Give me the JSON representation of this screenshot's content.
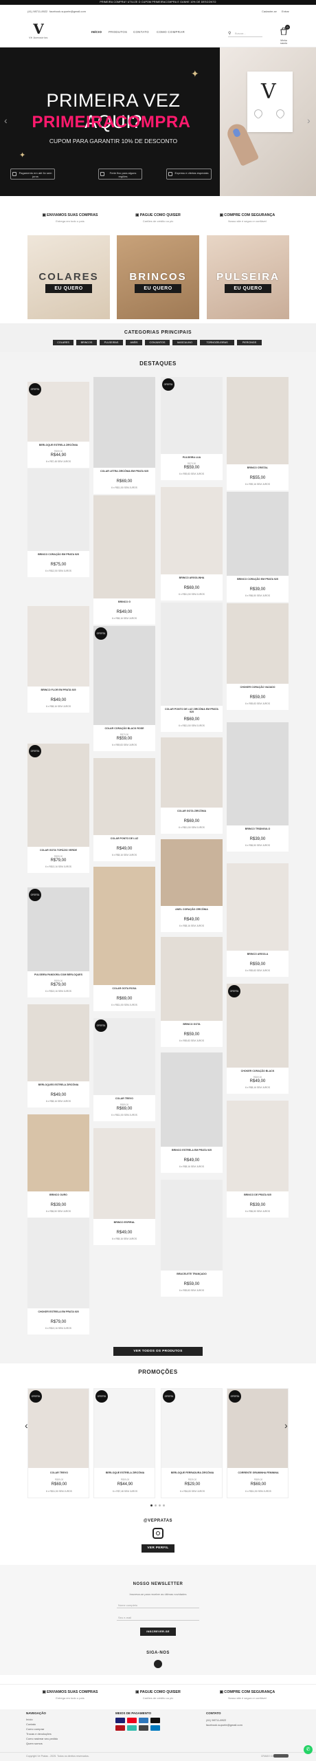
{
  "topbar": {
    "text": "PRIMEIRA COMPRA? UTILIZE O CUPOM PRIMEIRACOMPRA E GANHE 10% DE DESCONTO"
  },
  "info": {
    "phone": "(41) 98711-8922",
    "email": "facebook.suporte@gmail.com",
    "account": "Cadastre-se",
    "login": "Entrar"
  },
  "brand": {
    "mark": "V",
    "name": "Vê Acessórios"
  },
  "nav": [
    "INÍCIO",
    "PRODUTOS",
    "CONTATO",
    "COMO COMPRAR"
  ],
  "search": {
    "placeholder": "Buscar..."
  },
  "cart": {
    "count": "0",
    "label": "Minha sacola"
  },
  "hero": {
    "line1": "PRIMEIRA VEZ AQUI?",
    "line2": "PRIMEIRACOMPRA",
    "line3": "CUPOM PARA GARANTIR 10% DE DESCONTO",
    "perks": [
      "Pagamento em até 6x sem juros",
      "Frete fixo para alguns regiões",
      "Express e ofertas especiais"
    ],
    "accent": "#ff1a6e"
  },
  "features": [
    {
      "title": "ENVIAMOS SUAS COMPRAS",
      "sub": "Entrega em todo o país"
    },
    {
      "title": "PAGUE COMO QUISER",
      "sub": "Cartões de crédito ou pix"
    },
    {
      "title": "COMPRE COM SEGURANÇA",
      "sub": "Nosso site é seguro e confiável"
    }
  ],
  "categories": [
    {
      "title": "COLARES",
      "cta": "EU QUERO"
    },
    {
      "title": "BRINCOS",
      "cta": "EU QUERO"
    },
    {
      "title": "PULSEIRA",
      "cta": "EU QUERO"
    }
  ],
  "cats_principais": {
    "title": "CATEGORIAS PRINCIPAIS",
    "items": [
      "COLARES",
      "BRINCOS",
      "PULSEIRAS",
      "ANÉIS",
      "CONJUNTOS",
      "MASCULINO",
      "TORNOZELEIRAS",
      "PIERCINGS"
    ]
  },
  "destaques": {
    "title": "DESTAQUES",
    "badge": "OFERTA",
    "see_all": "VER TODOS OS PRODUTOS"
  },
  "products": [
    {
      "name": "BERLOQUE ESTRELA ZIRCÔNIA",
      "old": "R$59,00",
      "price": "R$44,90",
      "inst": "6 x R$7,48 SEM JUROS"
    },
    {
      "name": "COLAR LETRA ZIRCÔNIA EM PRATA 925",
      "old": "",
      "price": "R$69,00",
      "inst": "6 x R$11,50 SEM JUROS"
    },
    {
      "name": "PULSEIRA LUA",
      "old": "R$79,90",
      "price": "R$59,00",
      "inst": "6 x R$9,83 SEM JUROS"
    },
    {
      "name": "BRINCO CRISTAL",
      "old": "",
      "price": "R$55,00",
      "inst": "6 x R$9,16 SEM JUROS"
    },
    {
      "name": "BRINCO CORAÇÃO EM PRATA 925",
      "old": "",
      "price": "R$75,00",
      "inst": "6 x R$12,50 SEM JUROS"
    },
    {
      "name": "BRINCO G",
      "old": "",
      "price": "R$49,00",
      "inst": "6 x R$8,16 SEM JUROS"
    },
    {
      "name": "BRINCO ARGOLINHA",
      "old": "",
      "price": "R$69,00",
      "inst": "6 x R$11,50 SEM JUROS"
    },
    {
      "name": "BRINCO CORAÇÃO EM PRATA 925",
      "old": "",
      "price": "R$39,00",
      "inst": "6 x R$6,50 SEM JUROS"
    },
    {
      "name": "BRINCO FLOR EM PRATA 925",
      "old": "",
      "price": "R$49,00",
      "inst": "6 x R$8,16 SEM JUROS"
    },
    {
      "name": "COLAR CORAÇÃO BLACK ROSE",
      "old": "R$79,90",
      "price": "R$59,00",
      "inst": "6 x R$9,83 SEM JUROS"
    },
    {
      "name": "COLAR PONTO DE LUZ ZIRCÔNIA EM PRATA 925",
      "old": "",
      "price": "R$69,00",
      "inst": "6 x R$11,50 SEM JUROS"
    },
    {
      "name": "CHOKER CORAÇÃO VAZADO",
      "old": "",
      "price": "R$59,00",
      "inst": "6 x R$9,83 SEM JUROS"
    },
    {
      "name": "COLAR GOTA ZIRCÔNIA",
      "old": "",
      "price": "R$69,00",
      "inst": "6 x R$11,50 SEM JUROS"
    },
    {
      "name": "COLAR PONTO DE LUZ",
      "old": "",
      "price": "R$49,00",
      "inst": "6 x R$8,16 SEM JUROS"
    },
    {
      "name": "COLAR GOTA TOPÁZIO VERDE",
      "old": "R$99,00",
      "price": "R$79,00",
      "inst": "6 x R$13,16 SEM JUROS"
    },
    {
      "name": "BRINCO TRIÂNGULO",
      "old": "",
      "price": "R$39,00",
      "inst": "6 x R$6,50 SEM JUROS"
    },
    {
      "name": "COLAR GOTA ROSA",
      "old": "",
      "price": "R$69,00",
      "inst": "6 x R$11,50 SEM JUROS"
    },
    {
      "name": "ANEL CORAÇÃO ZIRCÔNIA",
      "old": "",
      "price": "R$49,00",
      "inst": "6 x R$8,16 SEM JUROS"
    },
    {
      "name": "PULSEIRA PANDORA COM BERLOQUES",
      "old": "R$99,00",
      "price": "R$79,00",
      "inst": "6 x R$13,16 SEM JUROS"
    },
    {
      "name": "COLAR TREVO",
      "old": "R$89,00",
      "price": "R$69,00",
      "inst": "6 x R$11,50 SEM JUROS"
    },
    {
      "name": "BRINCO GOTA",
      "old": "",
      "price": "R$59,00",
      "inst": "6 x R$9,83 SEM JUROS"
    },
    {
      "name": "BRINCO ARGOLA",
      "old": "",
      "price": "R$59,00",
      "inst": "6 x R$9,83 SEM JUROS"
    },
    {
      "name": "BERLOQUES ESTRELA ZIRCÔNIA",
      "old": "",
      "price": "R$49,00",
      "inst": "6 x R$8,16 SEM JUROS"
    },
    {
      "name": "BRINCO ESPIRAL",
      "old": "",
      "price": "R$49,00",
      "inst": "6 x R$8,16 SEM JUROS"
    },
    {
      "name": "BRINCO ESTRELA EM PRATA 925",
      "old": "",
      "price": "R$49,00",
      "inst": "6 x R$8,16 SEM JUROS"
    },
    {
      "name": "BRINCO OURO",
      "old": "",
      "price": "R$39,00",
      "inst": "6 x R$6,50 SEM JUROS"
    },
    {
      "name": "BRACELETE TRANÇADO",
      "old": "",
      "price": "R$59,00",
      "inst": "6 x R$9,83 SEM JUROS"
    },
    {
      "name": "CHOKER CORAÇÃO BLACK",
      "old": "R$69,00",
      "price": "R$49,00",
      "inst": "6 x R$8,16 SEM JUROS"
    },
    {
      "name": "CHOKER ESTRELA EM PRATA 925",
      "old": "",
      "price": "R$79,00",
      "inst": "6 x R$13,16 SEM JUROS"
    },
    {
      "name": "BRINCO DE PRATA 925",
      "old": "",
      "price": "R$39,00",
      "inst": "6 x R$6,50 SEM JUROS"
    }
  ],
  "promocoes": {
    "title": "PROMOÇÕES",
    "items": [
      {
        "name": "COLAR TREVO",
        "old": "R$89,00",
        "price": "R$69,00",
        "inst": "6 x R$11,50 SEM JUROS"
      },
      {
        "name": "BERLOQUE ESTRELA ZIRCÔNIA",
        "old": "R$59,00",
        "price": "R$44,90",
        "inst": "6 x R$7,48 SEM JUROS"
      },
      {
        "name": "BERLOQUE FERRADURA ZIRCÔNIA",
        "old": "R$39,00",
        "price": "R$29,00",
        "inst": "6 x R$4,83 SEM JUROS"
      },
      {
        "name": "CORRENTE GRUMINHA FEMININA",
        "old": "R$89,00",
        "price": "R$69,00",
        "inst": "6 x R$11,50 SEM JUROS"
      }
    ]
  },
  "instagram": {
    "handle": "@VEPRATAS",
    "button": "VER PERFIL"
  },
  "newsletter": {
    "title": "NOSSO NEWSLETTER",
    "sub": "Inscreva-se para receber as últimas novidades",
    "name_placeholder": "Nome completo",
    "email_placeholder": "Seu e-mail",
    "button": "INSCREVER-SE"
  },
  "follow": {
    "title": "SIGA-NOS"
  },
  "footer": {
    "nav_title": "NAVEGAÇÃO",
    "nav": [
      "Início",
      "Contato",
      "Como comprar",
      "Trocas e devoluções",
      "Como rastrear seu pedido",
      "Quem somos"
    ],
    "pay_title": "MEIOS DE PAGAMENTO",
    "pay": [
      {
        "name": "visa",
        "color": "#1a1f71"
      },
      {
        "name": "mastercard",
        "color": "#eb001b"
      },
      {
        "name": "amex",
        "color": "#2e77bc"
      },
      {
        "name": "elo",
        "color": "#111111"
      },
      {
        "name": "hipercard",
        "color": "#b3131b"
      },
      {
        "name": "pix",
        "color": "#32bcad"
      },
      {
        "name": "boleto",
        "color": "#444444"
      },
      {
        "name": "diners",
        "color": "#0079be"
      }
    ],
    "contact_title": "CONTATO",
    "contact": [
      "(41) 98711-8922",
      "facebook.suporte@gmail.com"
    ],
    "copyright": "Copyright Ve Pratas - 2025. Todos os direitos reservados.",
    "made_with": "CRIADO COM"
  }
}
